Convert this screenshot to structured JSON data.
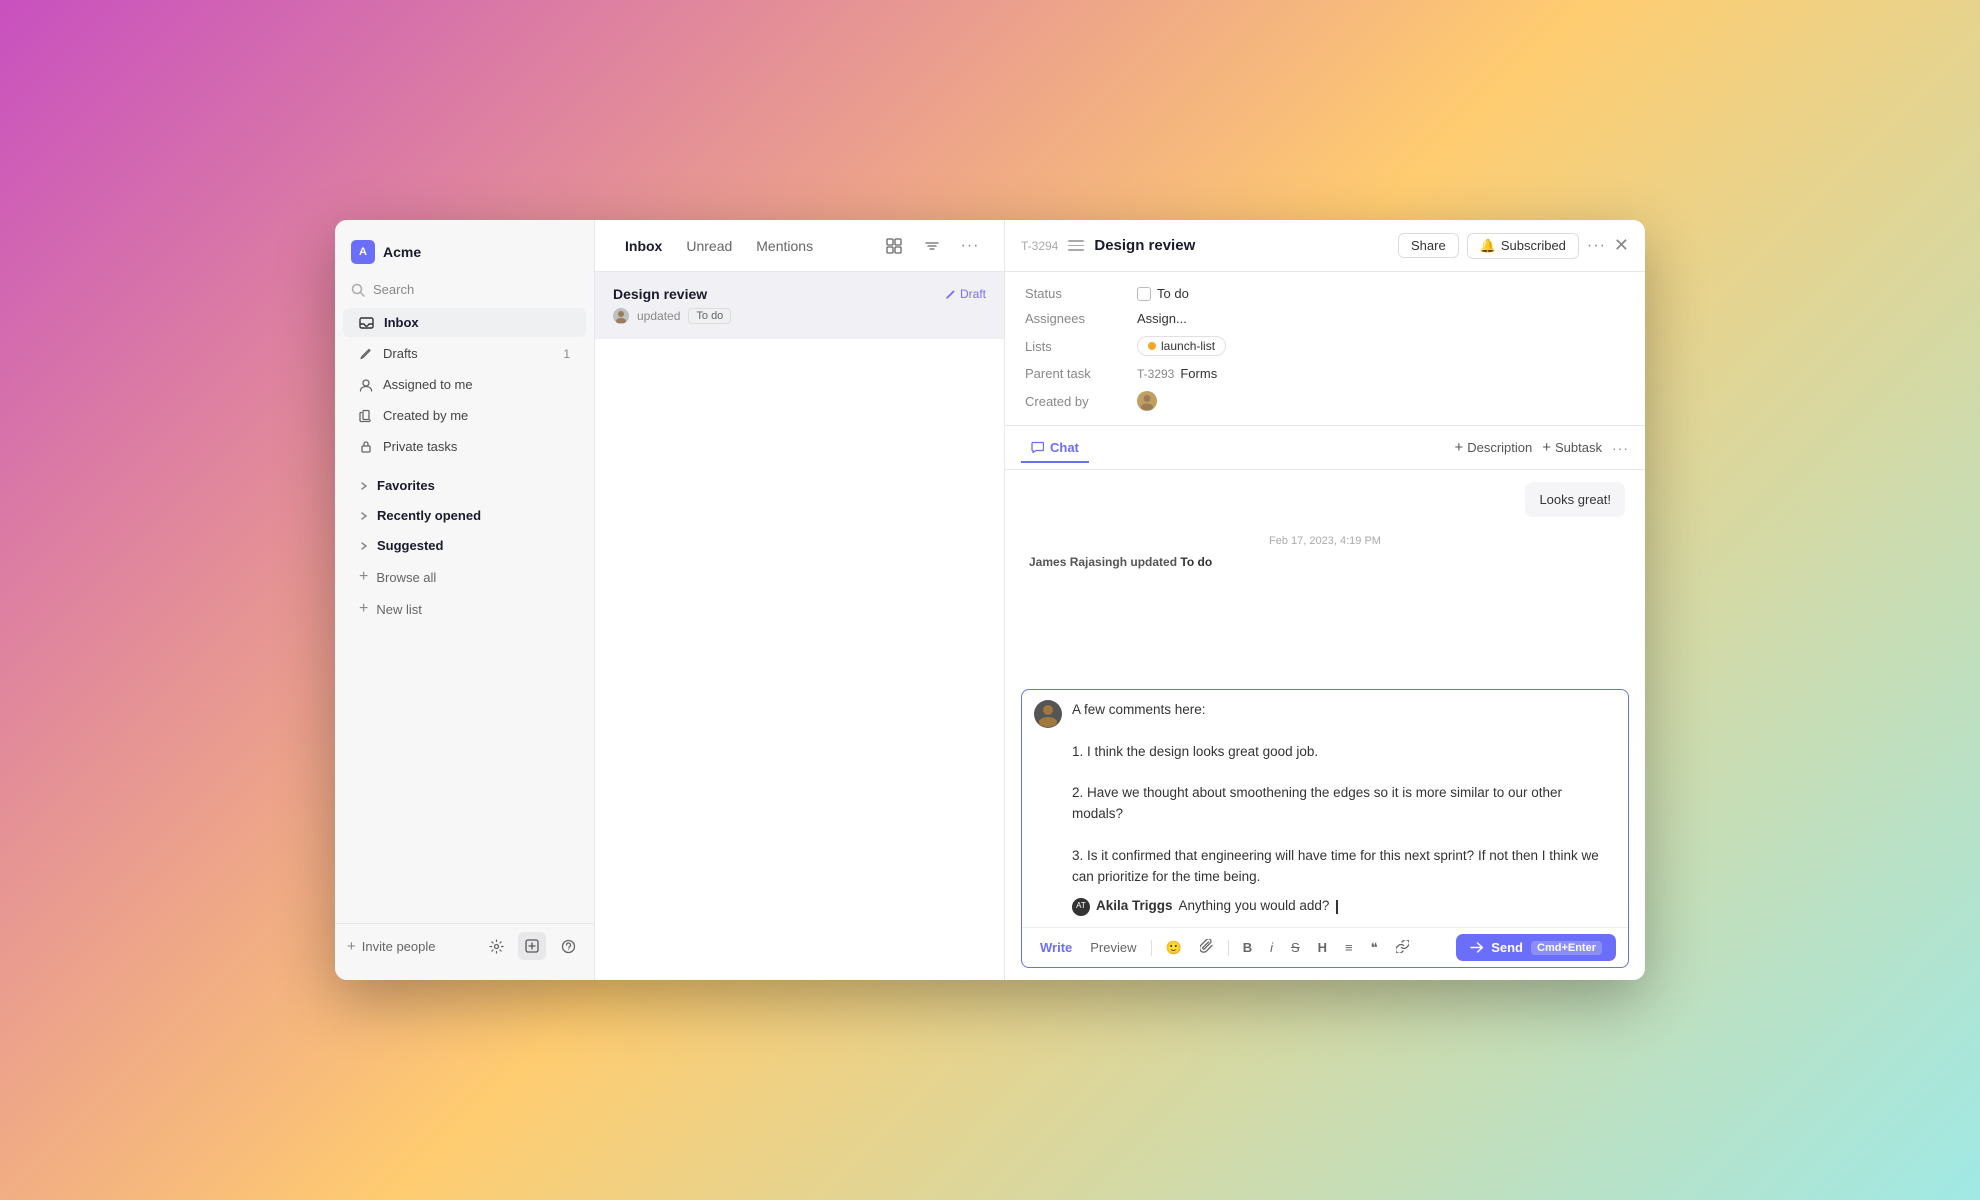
{
  "app": {
    "name": "Acme",
    "icon_label": "A"
  },
  "sidebar": {
    "search_placeholder": "Search",
    "nav_items": [
      {
        "id": "inbox",
        "label": "Inbox",
        "icon": "inbox",
        "active": true
      },
      {
        "id": "drafts",
        "label": "Drafts",
        "icon": "pencil",
        "count": "1"
      },
      {
        "id": "assigned",
        "label": "Assigned to me",
        "icon": "user"
      },
      {
        "id": "created",
        "label": "Created by me",
        "icon": "lock"
      },
      {
        "id": "private",
        "label": "Private tasks",
        "icon": "lock"
      }
    ],
    "sections": [
      {
        "id": "favorites",
        "label": "Favorites"
      },
      {
        "id": "recently",
        "label": "Recently opened"
      },
      {
        "id": "suggested",
        "label": "Suggested"
      }
    ],
    "actions": [
      {
        "id": "browse",
        "label": "Browse all"
      },
      {
        "id": "new-list",
        "label": "New list"
      }
    ],
    "footer": {
      "invite_label": "Invite people"
    }
  },
  "inbox": {
    "tabs": [
      {
        "id": "inbox",
        "label": "Inbox",
        "active": true
      },
      {
        "id": "unread",
        "label": "Unread"
      },
      {
        "id": "mentions",
        "label": "Mentions"
      }
    ],
    "items": [
      {
        "title": "Design review",
        "draft_label": "Draft",
        "meta_user": "updated",
        "meta_status": "To do"
      }
    ]
  },
  "detail": {
    "task_id": "T-3294",
    "task_title": "Design review",
    "share_label": "Share",
    "subscribed_label": "Subscribed",
    "more_label": "...",
    "meta": {
      "status_label": "Status",
      "status_value": "To do",
      "assignees_label": "Assignees",
      "assignees_value": "Assign...",
      "lists_label": "Lists",
      "list_value": "launch-list",
      "parent_task_label": "Parent task",
      "parent_task_id": "T-3293",
      "parent_task_name": "Forms",
      "created_by_label": "Created by"
    }
  },
  "chat": {
    "tab_label": "Chat",
    "tabs": [
      {
        "id": "chat",
        "label": "Chat",
        "active": true
      },
      {
        "id": "description",
        "label": "Description"
      },
      {
        "id": "subtask",
        "label": "Subtask"
      }
    ],
    "messages": [
      {
        "type": "bubble",
        "text": "Looks great!"
      },
      {
        "type": "timestamp",
        "text": "Feb 17, 2023, 4:19 PM"
      },
      {
        "type": "system",
        "user": "James Rajasingh",
        "action": "updated",
        "value": "To do"
      }
    ],
    "compose": {
      "lines": [
        "A few comments here:",
        "",
        "1. I think the design looks great good job.",
        "",
        "2. Have we thought about smoothening the edges so it is more similar to our other modals?",
        "",
        "3. Is it confirmed that engineering will have time for this next sprint? If not then I think we can prioritize for the time being."
      ],
      "mention_user": "Akila Triggs",
      "mention_text": "Anything you would add?"
    },
    "toolbar": {
      "write_label": "Write",
      "preview_label": "Preview",
      "bold_label": "B",
      "italic_label": "i",
      "strikethrough_label": "S",
      "heading_label": "H",
      "list_label": "≡",
      "quote_label": "❝",
      "link_label": "🔗",
      "send_label": "Send",
      "send_shortcut": "Cmd+Enter"
    }
  }
}
